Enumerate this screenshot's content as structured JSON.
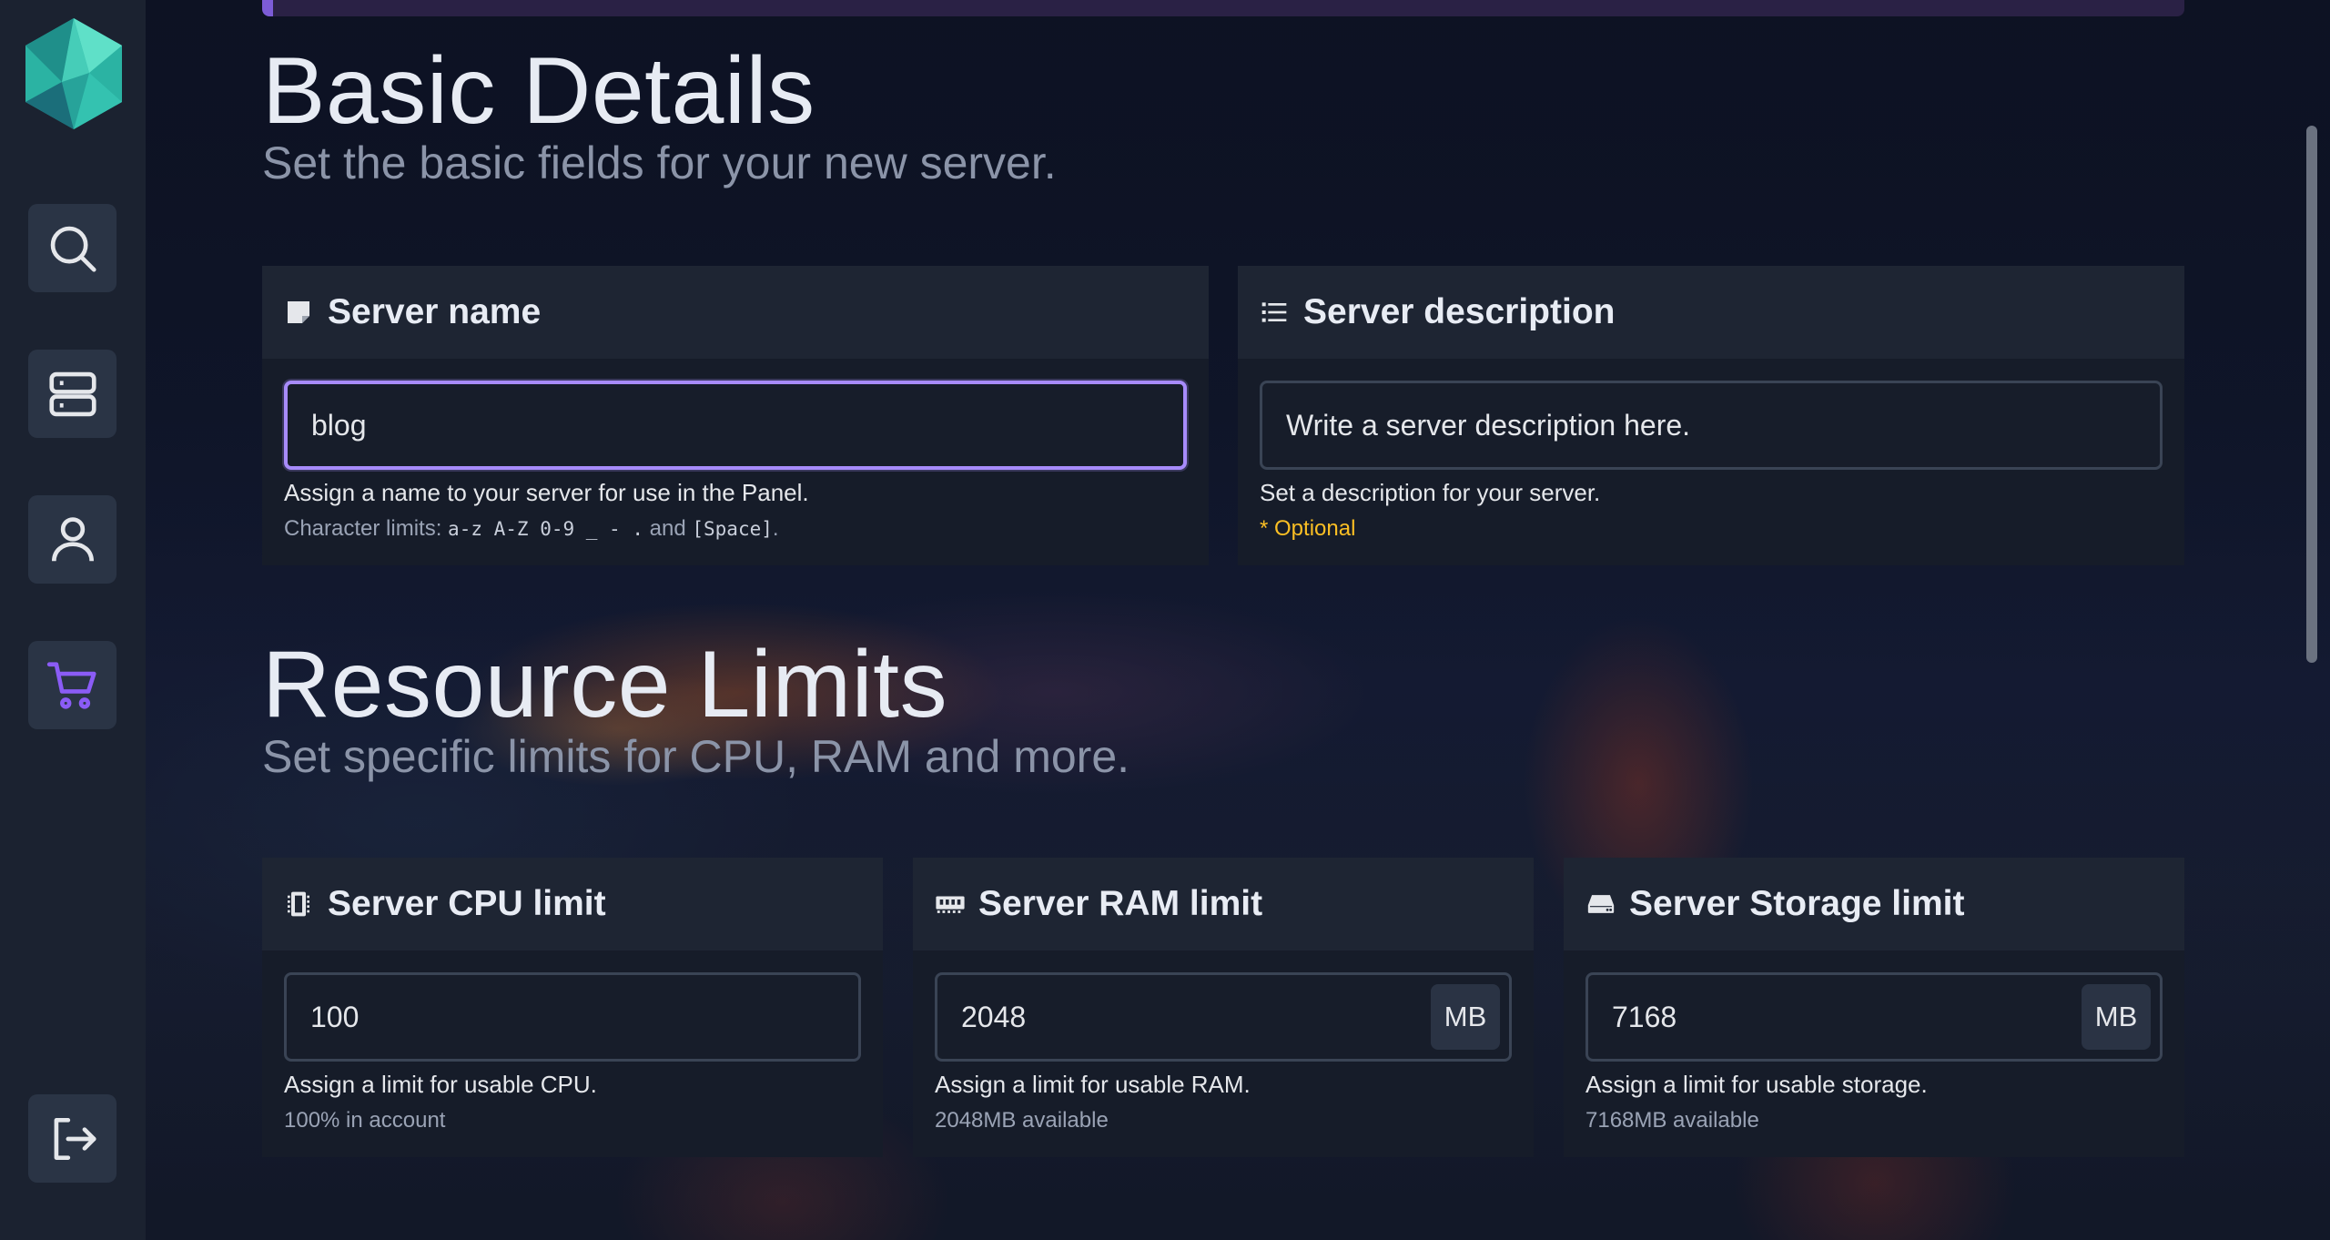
{
  "colors": {
    "accent": "#a78bfa",
    "sidebar": "#1b2230",
    "card": "#161c29",
    "card_header": "#1e2533",
    "optional": "#fbbf24",
    "cart_icon": "#8b5cf6"
  },
  "sidebar": {
    "logo": "panel-logo",
    "items": [
      {
        "icon": "search-icon"
      },
      {
        "icon": "servers-icon"
      },
      {
        "icon": "user-icon"
      },
      {
        "icon": "cart-icon",
        "active": true
      }
    ],
    "logout_icon": "logout-icon"
  },
  "basic": {
    "title": "Basic Details",
    "subtitle": "Set the basic fields for your new server.",
    "name_card": {
      "icon": "note-icon",
      "title": "Server name",
      "value": "blog",
      "help": "Assign a name to your server for use in the Panel.",
      "limits_prefix": "Character limits: ",
      "limits_chars": "a-z A-Z 0-9 _ - .",
      "limits_and": " and ",
      "limits_space": "[Space]",
      "limits_end": "."
    },
    "desc_card": {
      "icon": "list-icon",
      "title": "Server description",
      "placeholder": "Write a server description here.",
      "help": "Set a description for your server.",
      "optional": "* Optional"
    }
  },
  "resources": {
    "title": "Resource Limits",
    "subtitle": "Set specific limits for CPU, RAM and more.",
    "cpu": {
      "icon": "cpu-icon",
      "title": "Server CPU limit",
      "value": "100",
      "help": "Assign a limit for usable CPU.",
      "available": "100% in account"
    },
    "ram": {
      "icon": "memory-icon",
      "title": "Server RAM limit",
      "value": "2048",
      "unit": "MB",
      "help": "Assign a limit for usable RAM.",
      "available": "2048MB available"
    },
    "storage": {
      "icon": "hdd-icon",
      "title": "Server Storage limit",
      "value": "7168",
      "unit": "MB",
      "help": "Assign a limit for usable storage.",
      "available": "7168MB available"
    }
  }
}
